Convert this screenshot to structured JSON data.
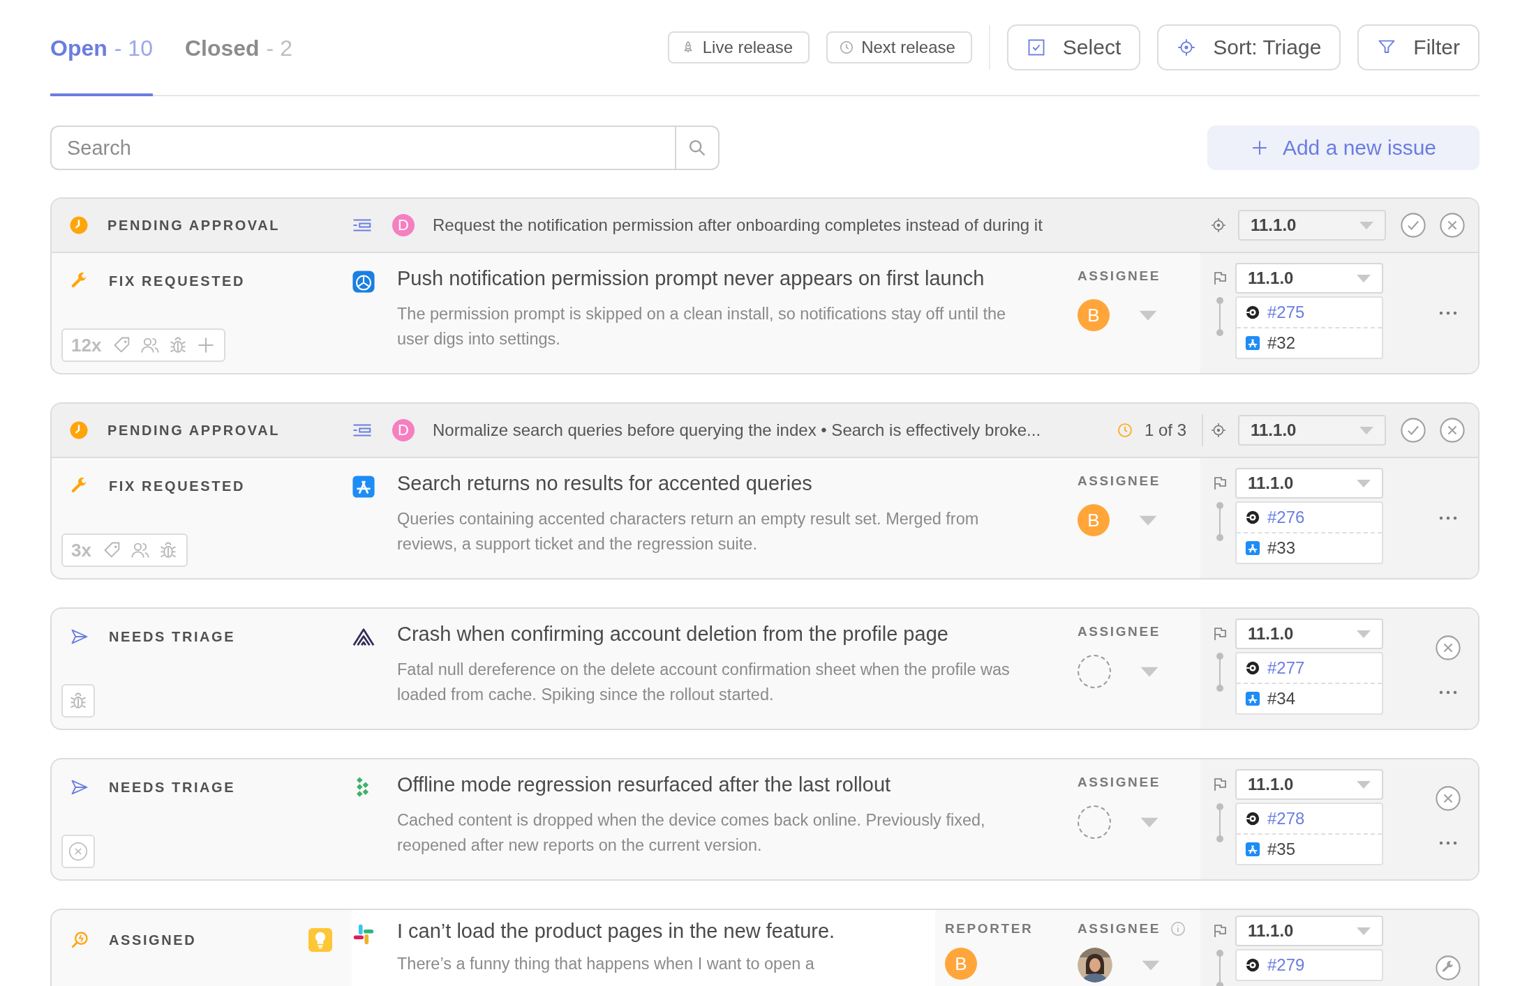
{
  "tabs": [
    {
      "label": "Open",
      "count": "- 10",
      "selected": true
    },
    {
      "label": "Closed",
      "count": "- 2",
      "selected": false
    }
  ],
  "toolbar": {
    "release_buttons": [
      {
        "kind": "live",
        "label": "Live release"
      },
      {
        "kind": "next",
        "label": "Next release"
      }
    ],
    "buttons": [
      {
        "kind": "select",
        "label": "Select"
      },
      {
        "kind": "sort",
        "label": "Sort: Triage"
      },
      {
        "kind": "filter",
        "label": "Filter"
      }
    ]
  },
  "search": {
    "placeholder": "Search"
  },
  "add_button": {
    "label": "Add a new issue"
  },
  "issues": [
    {
      "header": {
        "status": "PENDING APPROVAL",
        "author": "D",
        "text": "Request the notification permission after onboarding completes instead of during it",
        "version": "11.1.0",
        "actions": [
          {
            "kind": "approve"
          },
          {
            "kind": "dismiss"
          }
        ]
      },
      "status": {
        "kind": "fix",
        "label": "FIX REQUESTED"
      },
      "tags": {
        "count": "12x",
        "icons": [
          {
            "kind": "tag"
          },
          {
            "kind": "people"
          },
          {
            "kind": "bug"
          },
          {
            "kind": "plus"
          }
        ]
      },
      "source": {
        "kind": "xcode"
      },
      "title": "Push notification permission prompt never appears on first launch",
      "description": "The permission prompt is skipped on a clean install, so notifications stay off until the user digs into settings.",
      "assignee": {
        "label": "ASSIGNEE",
        "kind": "letter",
        "initial": "B"
      },
      "version": "11.1.0",
      "links": [
        {
          "kind": "ticket",
          "text": "#275"
        },
        {
          "kind": "store",
          "text": "#32"
        }
      ],
      "actions": [
        {
          "kind": "more"
        }
      ]
    },
    {
      "header": {
        "status": "PENDING APPROVAL",
        "author": "D",
        "text": "Normalize search queries before querying the index • Search is effectively broke...",
        "count": "1 of 3",
        "version": "11.1.0",
        "actions": [
          {
            "kind": "approve"
          },
          {
            "kind": "dismiss"
          }
        ]
      },
      "status": {
        "kind": "fix",
        "label": "FIX REQUESTED"
      },
      "tags": {
        "count": "3x",
        "icons": [
          {
            "kind": "tag"
          },
          {
            "kind": "people"
          },
          {
            "kind": "bug"
          }
        ]
      },
      "source": {
        "kind": "appstore"
      },
      "title": "Search returns no results for accented queries",
      "description": "Queries containing accented characters return an empty result set. Merged from reviews, a support ticket and the regression suite.",
      "assignee": {
        "label": "ASSIGNEE",
        "kind": "letter",
        "initial": "B"
      },
      "version": "11.1.0",
      "links": [
        {
          "kind": "ticket",
          "text": "#276"
        },
        {
          "kind": "store",
          "text": "#33"
        }
      ],
      "actions": [
        {
          "kind": "more"
        }
      ]
    },
    {
      "status": {
        "kind": "triage",
        "label": "NEEDS TRIAGE"
      },
      "tags": {
        "icons": [
          {
            "kind": "bug"
          }
        ]
      },
      "source": {
        "kind": "sentry"
      },
      "title": "Crash when confirming account deletion from the profile page",
      "description": "Fatal null dereference on the delete account confirmation sheet when the profile was loaded from cache. Spiking since the rollout started.",
      "assignee": {
        "label": "ASSIGNEE",
        "kind": "empty"
      },
      "version": "11.1.0",
      "links": [
        {
          "kind": "ticket",
          "text": "#277"
        },
        {
          "kind": "store",
          "text": "#34"
        }
      ],
      "actions": [
        {
          "kind": "dismiss"
        },
        {
          "kind": "more"
        }
      ]
    },
    {
      "status": {
        "kind": "triage",
        "label": "NEEDS TRIAGE"
      },
      "tags": {
        "icons": [
          {
            "kind": "dismiss"
          }
        ]
      },
      "source": {
        "kind": "diamonds"
      },
      "title": "Offline mode regression resurfaced after the last rollout",
      "description": "Cached content is dropped when the device comes back online. Previously fixed, reopened after new reports on the current version.",
      "assignee": {
        "label": "ASSIGNEE",
        "kind": "empty"
      },
      "version": "11.1.0",
      "links": [
        {
          "kind": "ticket",
          "text": "#278"
        },
        {
          "kind": "store",
          "text": "#35"
        }
      ],
      "actions": [
        {
          "kind": "dismiss"
        },
        {
          "kind": "more"
        }
      ]
    },
    {
      "status": {
        "kind": "assigned",
        "label": "ASSIGNED",
        "badge": {
          "kind": "bulb"
        }
      },
      "source": {
        "kind": "slack"
      },
      "title": "I can’t load the product pages in the new feature.",
      "description": "There’s a funny thing that happens when I want to open a",
      "reporter": {
        "label": "REPORTER",
        "kind": "letter",
        "initial": "B"
      },
      "assignee": {
        "label": "ASSIGNEE",
        "kind": "picture",
        "info": true
      },
      "version": "11.1.0",
      "links": [
        {
          "kind": "ticket",
          "text": "#279"
        }
      ],
      "actions": [
        {
          "kind": "fix"
        }
      ]
    }
  ]
}
